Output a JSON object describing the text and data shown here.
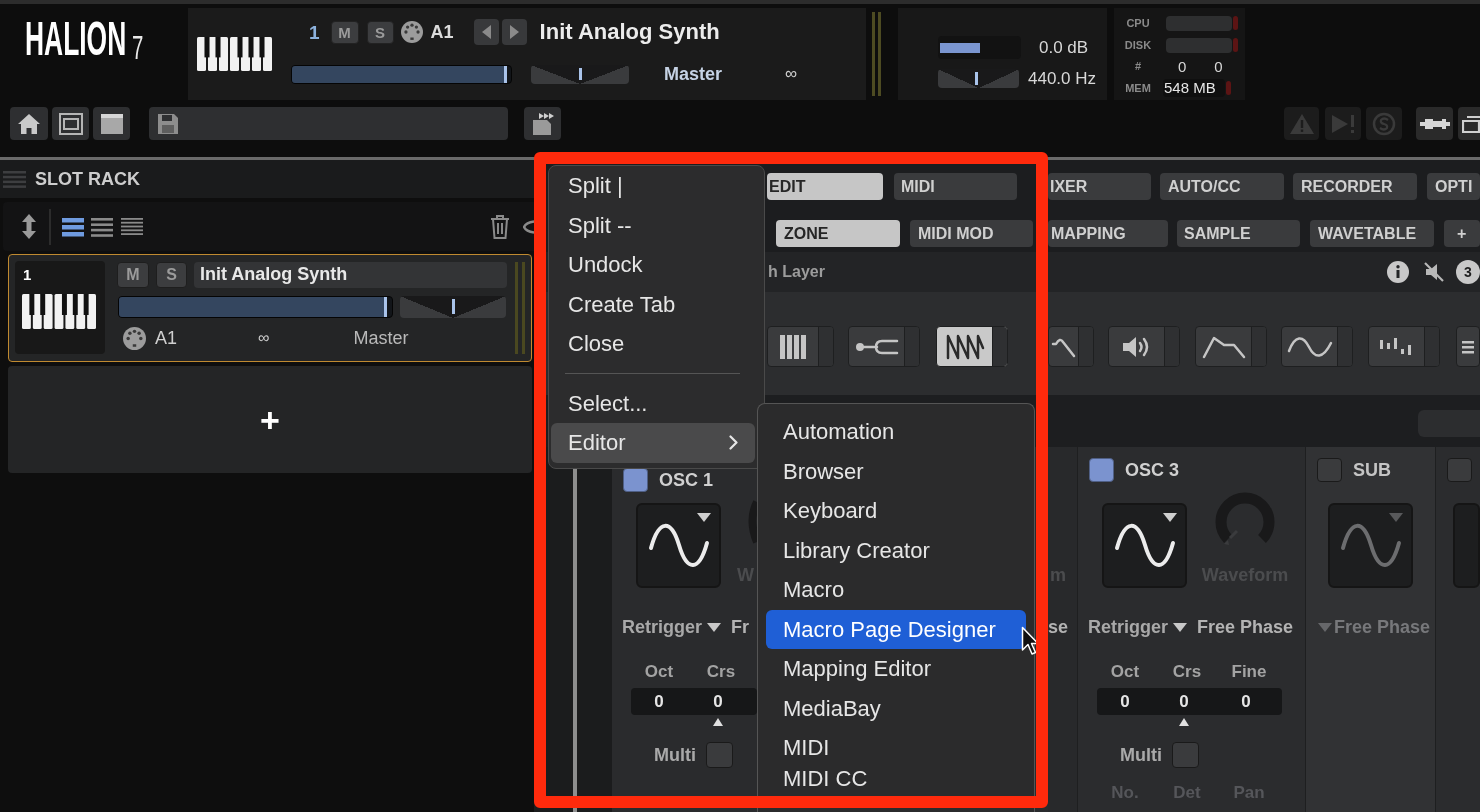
{
  "header": {
    "logo": {
      "name": "HALION",
      "version": "7"
    },
    "slot": {
      "number": "1",
      "mute": "M",
      "solo": "S",
      "midi_port": "A1",
      "program": "Init Analog Synth",
      "volume": {
        "level": 0.98
      },
      "pan": {
        "level": 0.5
      },
      "output": "Master",
      "link": "∞"
    },
    "master": {
      "volume": {
        "level": 0.5,
        "reading": "0.0 dB"
      },
      "tune": {
        "level": 0.48,
        "reading": "440.0 Hz"
      }
    },
    "performance": [
      {
        "kind": "meter",
        "label": "CPU"
      },
      {
        "kind": "meter",
        "label": "DISK"
      },
      {
        "kind": "counts",
        "label": "#",
        "values": [
          "0",
          "0"
        ]
      },
      {
        "kind": "readout",
        "label": "MEM",
        "value": "548 MB"
      }
    ]
  },
  "slot_rack": {
    "title": "SLOT RACK",
    "view_modes": [
      {
        "selected": true
      },
      {
        "selected": false
      },
      {
        "selected": false
      }
    ],
    "slots": [
      {
        "number": "1",
        "selected": true,
        "mute": "M",
        "solo": "S",
        "program": "Init Analog Synth",
        "volume": {
          "level": 0.98
        },
        "pan": {
          "level": 0.5
        },
        "midi_port": "A1",
        "link": "∞",
        "output": "Master"
      }
    ],
    "add_slot": "+"
  },
  "editor": {
    "main_tabs": [
      {
        "label": "EDIT",
        "selected": true
      },
      {
        "label": "MIDI",
        "selected": false
      },
      {
        "label": "IXER",
        "selected": false
      },
      {
        "label": "AUTO/CC",
        "selected": false
      },
      {
        "label": "RECORDER",
        "selected": false
      },
      {
        "label": "OPTI",
        "selected": false
      }
    ],
    "sub_tabs": [
      {
        "label": "ZONE",
        "selected": true
      },
      {
        "label": "MIDI MOD",
        "selected": false
      },
      {
        "label": "MAPPING",
        "selected": false
      },
      {
        "label": "SAMPLE",
        "selected": false
      },
      {
        "label": "WAVETABLE",
        "selected": false
      },
      {
        "label": "+",
        "selected": false
      }
    ],
    "layer_row": {
      "title": "h Layer",
      "badge": "3"
    },
    "modules": [
      {
        "kind": "keys",
        "selected": false
      },
      {
        "kind": "connector",
        "selected": false
      },
      {
        "kind": "saw",
        "selected": true
      },
      {
        "kind": "filter",
        "selected": false
      },
      {
        "kind": "speaker",
        "selected": false
      },
      {
        "kind": "envelope",
        "selected": false
      },
      {
        "kind": "sine",
        "selected": false
      },
      {
        "kind": "steps",
        "selected": false
      },
      {
        "kind": "menu",
        "selected": false
      }
    ],
    "oscillators": [
      {
        "kind": "partial",
        "name": "OSC 1",
        "enabled": true,
        "waveform_label": "W",
        "retrigger": "Retrigger",
        "phase": "Fr",
        "tune": [
          {
            "label": "Oct",
            "value": "0"
          },
          {
            "label": "Crs",
            "value": "0"
          }
        ],
        "multi": {
          "label": "Multi",
          "checked": false
        }
      },
      {
        "kind": "fragment",
        "waveform_label": "m",
        "phase": "se"
      },
      {
        "kind": "full",
        "name": "OSC 3",
        "enabled": true,
        "waveform_label": "Waveform",
        "retrigger": "Retrigger",
        "phase": "Free Phase",
        "tune": [
          {
            "label": "Oct",
            "value": "0"
          },
          {
            "label": "Crs",
            "value": "0"
          },
          {
            "label": "Fine",
            "value": "0"
          }
        ],
        "multi": {
          "label": "Multi",
          "checked": false
        },
        "voice_labels": [
          "No.",
          "Det",
          "Pan"
        ]
      },
      {
        "kind": "sub",
        "name": "SUB",
        "enabled": false,
        "phase": "Free Phase"
      },
      {
        "kind": "edge",
        "enabled": false
      }
    ]
  },
  "context_menu": {
    "groups": [
      {
        "items": [
          {
            "label": "Split |",
            "selected": false,
            "has_submenu": false
          },
          {
            "label": "Split --",
            "selected": false,
            "has_submenu": false
          },
          {
            "label": "Undock",
            "selected": false,
            "has_submenu": false
          },
          {
            "label": "Create Tab",
            "selected": false,
            "has_submenu": false
          },
          {
            "label": "Close",
            "selected": false,
            "has_submenu": false
          }
        ]
      },
      {
        "items": [
          {
            "label": "Select...",
            "selected": false,
            "has_submenu": false
          },
          {
            "label": "Editor",
            "selected": true,
            "has_submenu": true
          }
        ]
      }
    ]
  },
  "submenu": {
    "items": [
      {
        "label": "Automation",
        "selected": false
      },
      {
        "label": "Browser",
        "selected": false
      },
      {
        "label": "Keyboard",
        "selected": false
      },
      {
        "label": "Library Creator",
        "selected": false
      },
      {
        "label": "Macro",
        "selected": false
      },
      {
        "label": "Macro Page Designer",
        "selected": true
      },
      {
        "label": "Mapping Editor",
        "selected": false
      },
      {
        "label": "MediaBay",
        "selected": false
      },
      {
        "label": "MIDI",
        "selected": false
      },
      {
        "label": "MIDI CC",
        "selected": false
      }
    ]
  }
}
